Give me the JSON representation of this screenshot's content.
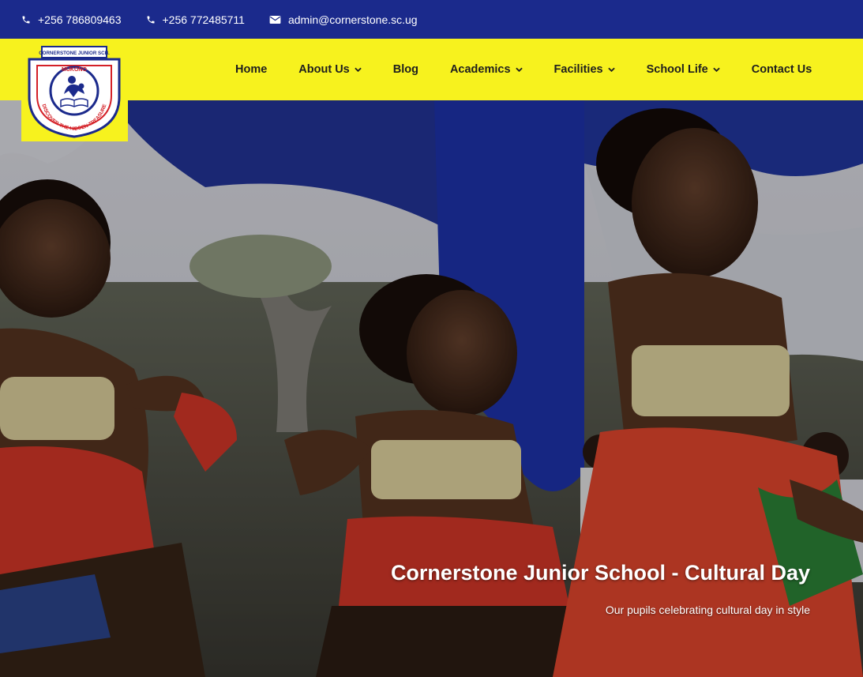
{
  "topbar": {
    "phone1": "+256 786809463",
    "phone2": "+256 772485711",
    "email": "admin@cornerstone.sc.ug"
  },
  "logo": {
    "top_text": "CORNERSTONE JUNIOR SCH.",
    "location": "MUKONO",
    "motto": "DISCOVER THE HIDDEN TREASURE"
  },
  "nav": {
    "items": [
      {
        "label": "Home",
        "dropdown": false
      },
      {
        "label": "About Us",
        "dropdown": true
      },
      {
        "label": "Blog",
        "dropdown": false
      },
      {
        "label": "Academics",
        "dropdown": true
      },
      {
        "label": "Facilities",
        "dropdown": true
      },
      {
        "label": "School Life",
        "dropdown": true
      },
      {
        "label": "Contact Us",
        "dropdown": false
      }
    ]
  },
  "hero": {
    "title": "Cornerstone Junior School - Cultural Day",
    "subtitle": "Our pupils celebrating cultural day in style"
  },
  "colors": {
    "topbar_bg": "#1b2a8c",
    "nav_bg": "#f7f21e"
  }
}
